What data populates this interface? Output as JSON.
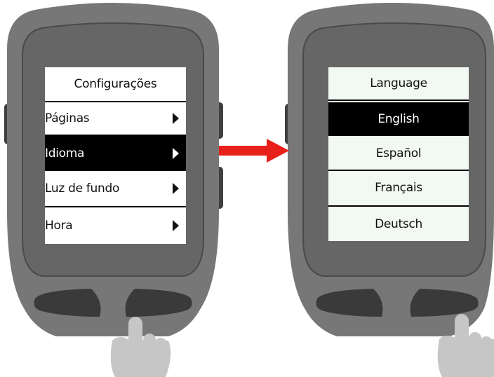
{
  "left_screen": {
    "title": "Configurações",
    "items": [
      {
        "label": "Páginas",
        "selected": false
      },
      {
        "label": "Idioma",
        "selected": true
      },
      {
        "label": "Luz de fundo",
        "selected": false
      },
      {
        "label": "Hora",
        "selected": false
      }
    ]
  },
  "right_screen": {
    "title": "Language",
    "items": [
      {
        "label": "English",
        "selected": true
      },
      {
        "label": "Español",
        "selected": false
      },
      {
        "label": "Français",
        "selected": false
      },
      {
        "label": "Deutsch",
        "selected": false
      }
    ]
  },
  "icons": {
    "transition": "right-arrow-icon",
    "pointer": "pointing-hand-icon",
    "submenu": "chevron-right-icon"
  },
  "colors": {
    "device_body": "#7a7a7a",
    "device_trim": "#5e5e5e",
    "device_dark": "#3a3a3a",
    "arrow": "#e8201a",
    "hand": "#c8c8c8",
    "selection": "#000000"
  }
}
